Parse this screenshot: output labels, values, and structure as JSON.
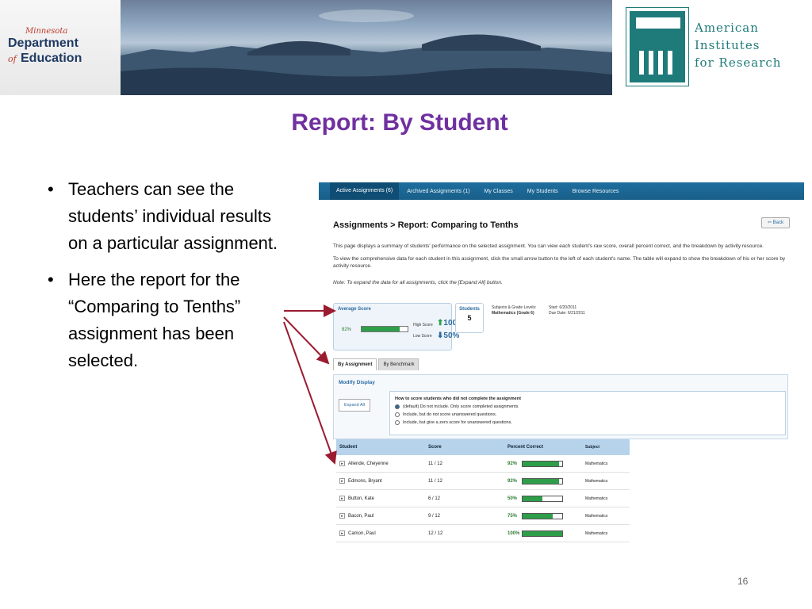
{
  "banner": {
    "mde": {
      "minnesota": "Minnesota",
      "department": "Department",
      "of": "of",
      "education": "Education"
    },
    "air": {
      "line1": "American",
      "line2": "Institutes",
      "line3": "for Research"
    }
  },
  "slide": {
    "title": "Report: By Student",
    "bullets": [
      "Teachers can see the students’ individual results on a particular assignment.",
      "Here the report for the “Comparing to Tenths” assignment has been selected."
    ],
    "page_number": "16"
  },
  "screenshot": {
    "tabs": [
      "Active Assignments (6)",
      "Archived Assignments (1)",
      "My Classes",
      "My Students",
      "Browse Resources"
    ],
    "heading": "Assignments > Report: Comparing to Tenths",
    "back_label": "⇦ Back",
    "desc1": "This page displays a summary of students' performance on the selected assignment. You can view each student's raw score, overall percent correct, and the breakdown by activity resource.",
    "desc2": "To view the comprehensive data for each student in this assignment, click the small arrow button to the left of each student's name. The table will expand to show the breakdown of his or her score by activity resource.",
    "note": "Note: To expand the data for all assignments, click the [Expand All] button.",
    "average": {
      "label": "Average Score",
      "pct": "82%",
      "fill": 0.82,
      "high_label": "High Score",
      "high_value": "100%",
      "low_label": "Low Score",
      "low_value": "50%"
    },
    "students": {
      "label": "Students",
      "value": "5"
    },
    "meta": {
      "subjects_label": "Subjects & Grade Levels:",
      "subjects_value": "Mathematics (Grade 6)",
      "start": "Start: 6/20/2011",
      "due": "Due Date: 6/21/2011"
    },
    "subtabs": [
      "By Assignment",
      "By Benchmark"
    ],
    "modify": {
      "title": "Modify Display",
      "expand_label": "Expand All",
      "question": "How to score students who did not complete the assignment",
      "options": [
        "(default) Do not include. Only score completed assignments",
        "Include, but do not score unanswered questions.",
        "Include, but give a zero score for unanswered questions."
      ]
    },
    "table": {
      "headers": [
        "Student",
        "Score",
        "Percent Correct",
        "Subject"
      ],
      "rows": [
        {
          "name": "Allende, Cheyenne",
          "score": "11 / 12",
          "pct": "92%",
          "fill": 0.92,
          "subject": "Mathematics"
        },
        {
          "name": "Edmons, Bryant",
          "score": "11 / 12",
          "pct": "92%",
          "fill": 0.92,
          "subject": "Mathematics"
        },
        {
          "name": "Button, Kate",
          "score": "6 / 12",
          "pct": "50%",
          "fill": 0.5,
          "subject": "Mathematics"
        },
        {
          "name": "Bacon, Paul",
          "score": "9 / 12",
          "pct": "75%",
          "fill": 0.75,
          "subject": "Mathematics"
        },
        {
          "name": "Camon, Paul",
          "score": "12 / 12",
          "pct": "100%",
          "fill": 1.0,
          "subject": "Mathematics"
        }
      ]
    }
  },
  "colors": {
    "title": "#7030a0",
    "arrow": "#9b1b30",
    "tab_bar": "#1e6e9e"
  }
}
